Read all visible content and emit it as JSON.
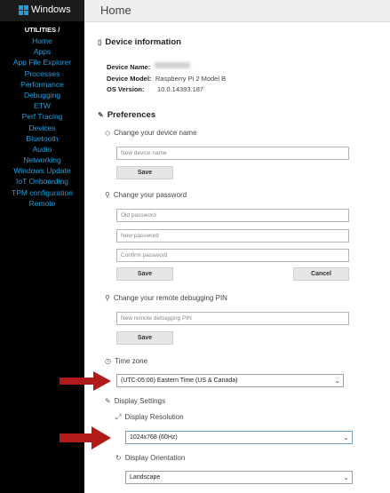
{
  "app": {
    "title": "Windows"
  },
  "sidebar": {
    "heading": "UTILITIES /",
    "items": [
      {
        "label": "Home"
      },
      {
        "label": "Apps"
      },
      {
        "label": "App File Explorer"
      },
      {
        "label": "Processes"
      },
      {
        "label": "Performance"
      },
      {
        "label": "Debugging"
      },
      {
        "label": "ETW"
      },
      {
        "label": "Perf Tracing"
      },
      {
        "label": "Devices"
      },
      {
        "label": "Bluetooth"
      },
      {
        "label": "Audio"
      },
      {
        "label": "Networking"
      },
      {
        "label": "Windows Update"
      },
      {
        "label": "IoT Onboarding"
      },
      {
        "label": "TPM configuration"
      },
      {
        "label": "Remote"
      }
    ]
  },
  "header": {
    "title": "Home"
  },
  "device_info": {
    "title": "Device information",
    "name_label": "Device Name:",
    "name_value": "",
    "model_label": "Device Model:",
    "model_value": "Raspberry Pi 2 Model B",
    "os_label": "OS Version:",
    "os_value": "10.0.14393.187"
  },
  "preferences": {
    "title": "Preferences",
    "change_name": {
      "title": "Change your device name",
      "placeholder": "New device name",
      "save_label": "Save"
    },
    "change_password": {
      "title": "Change your password",
      "old_placeholder": "Old password",
      "new_placeholder": "New password",
      "confirm_placeholder": "Confirm password",
      "save_label": "Save",
      "cancel_label": "Cancel"
    },
    "change_pin": {
      "title": "Change your remote debugging PIN",
      "placeholder": "New remote debugging PIN",
      "save_label": "Save"
    },
    "time_zone": {
      "title": "Time zone",
      "selected": "(UTC-05:00) Eastern Time (US & Canada)"
    },
    "display": {
      "title": "Display Settings",
      "resolution_title": "Display Resolution",
      "resolution_selected": "1024x768 (60Hz)",
      "orientation_title": "Display Orientation",
      "orientation_selected": "Landscape"
    }
  },
  "colors": {
    "sidebar_bg": "#000000",
    "link": "#1ba1e2",
    "annotation_arrow": "#b01a1a"
  },
  "icons": {
    "device": "device-icon",
    "pencil": "pencil-icon",
    "key": "key-icon",
    "clock": "clock-icon",
    "resize": "resize-icon",
    "rotate": "rotate-icon",
    "chevron": "chevron-down-icon"
  }
}
